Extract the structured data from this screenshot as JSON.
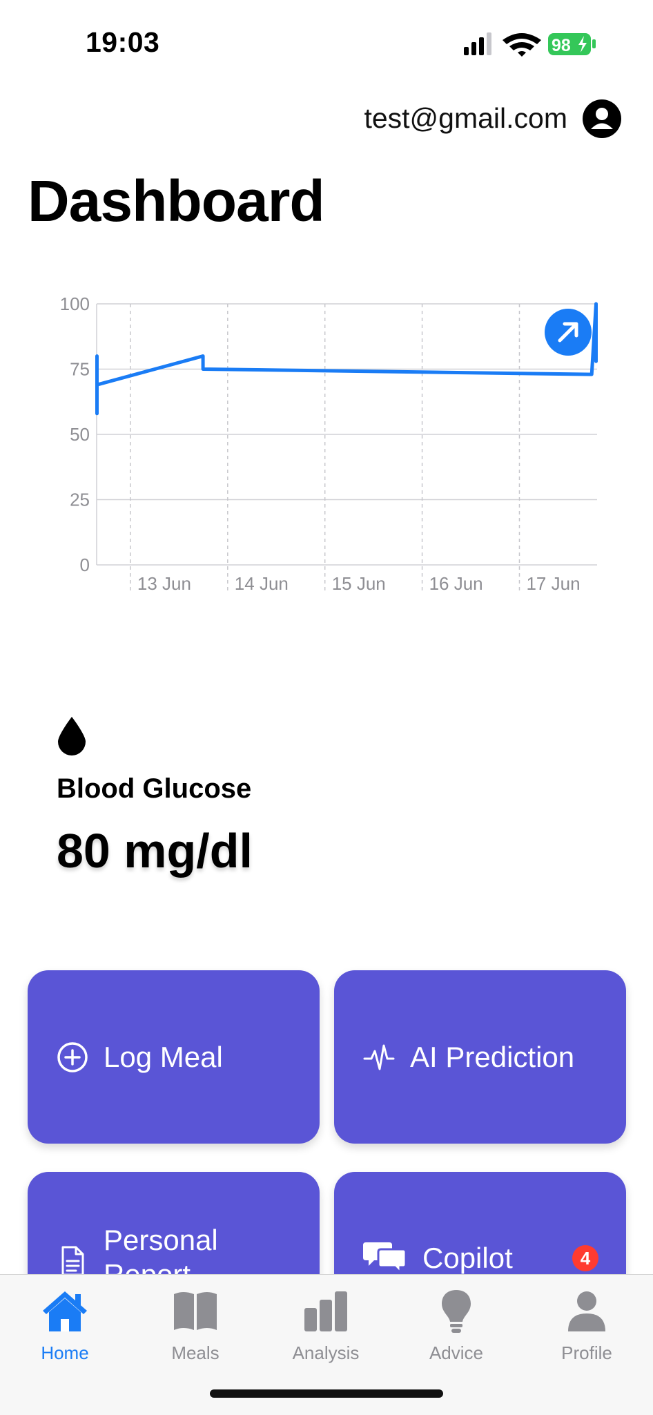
{
  "status_bar": {
    "time": "19:03",
    "battery": "98"
  },
  "header": {
    "email": "test@gmail.com",
    "title": "Dashboard"
  },
  "chart_data": {
    "type": "line",
    "title": "",
    "xlabel": "",
    "ylabel": "",
    "ylim": [
      0,
      100
    ],
    "y_ticks": [
      "100",
      "75",
      "50",
      "25",
      "0"
    ],
    "x_tick_labels": [
      "13 Jun",
      "14 Jun",
      "15 Jun",
      "16 Jun",
      "17 Jun"
    ],
    "xlim": [
      "2024-06-12T15:40",
      "2024-06-17T19:10"
    ],
    "grid": true,
    "series": [
      {
        "x": [
          "2024-06-12T15:45",
          "2024-06-12T15:45",
          "2024-06-12T15:45",
          "2024-06-12T15:45",
          "2024-06-13T17:55",
          "2024-06-13T17:55",
          "2024-06-17T17:50",
          "2024-06-17T18:55",
          "2024-06-17T18:55"
        ],
        "y": [
          58,
          80,
          80,
          69,
          80,
          75,
          73,
          100,
          78
        ],
        "color": "#1a7cf5"
      }
    ],
    "expand_button_color": "#1a7cf5"
  },
  "glucose": {
    "icon": "drop-icon",
    "label": "Blood Glucose",
    "value": "80 mg/dl"
  },
  "cards": {
    "log_meal": "Log Meal",
    "ai_prediction": "AI Prediction",
    "personal_report": "Personal Report",
    "copilot": "Copilot",
    "copilot_badge": "4",
    "card_color": "#5a55d6"
  },
  "tab_bar": {
    "items": [
      {
        "label": "Home",
        "icon": "house-icon",
        "active": true
      },
      {
        "label": "Meals",
        "icon": "book-icon",
        "active": false
      },
      {
        "label": "Analysis",
        "icon": "bar-chart-icon",
        "active": false
      },
      {
        "label": "Advice",
        "icon": "lightbulb-icon",
        "active": false
      },
      {
        "label": "Profile",
        "icon": "person-icon",
        "active": false
      }
    ],
    "active_color": "#1a7cf5",
    "inactive_color": "#8e8e93"
  }
}
